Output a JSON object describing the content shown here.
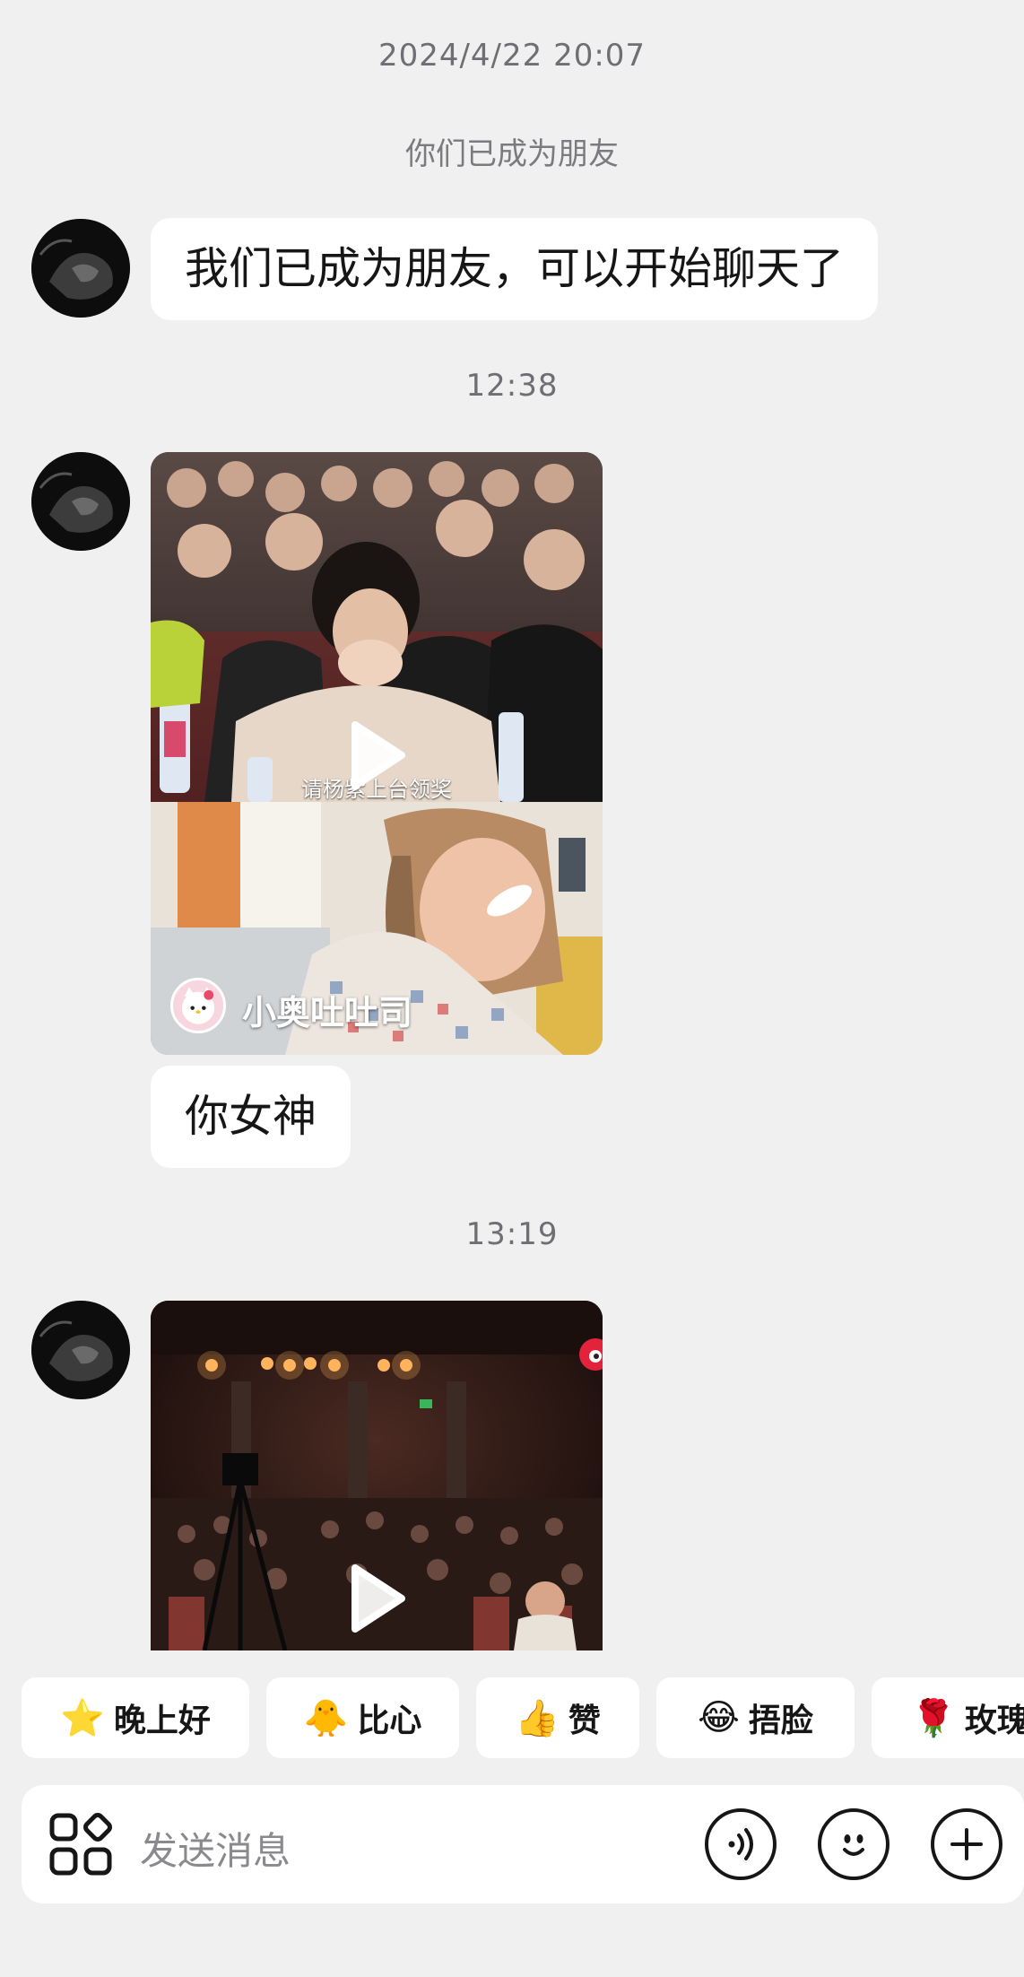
{
  "messages": {
    "timestamp1": "2024/4/22 20:07",
    "system_notice": "你们已成为朋友",
    "greeting": "我们已成为朋友，可以开始聊天了",
    "timestamp2": "12:38",
    "video1": {
      "caption": "请杨紫上台领奖",
      "author": "小奥吐吐司"
    },
    "reply": "你女神",
    "timestamp3": "13:19"
  },
  "quick_replies": [
    {
      "emoji": "⭐",
      "label": "晚上好"
    },
    {
      "emoji": "🐥",
      "label": "比心"
    },
    {
      "emoji": "👍",
      "label": "赞"
    },
    {
      "emoji": "😂",
      "label": "捂脸"
    },
    {
      "emoji": "🌹",
      "label": "玫瑰"
    }
  ],
  "input": {
    "placeholder": "发送消息"
  },
  "icons": {
    "apps": "apps-grid-icon",
    "voice": "voice-icon",
    "emoji": "emoji-face-icon",
    "add": "plus-icon"
  },
  "colors": {
    "background": "#f0f0f0",
    "bubble": "#ffffff",
    "timestamp_text": "#6e6e73"
  }
}
